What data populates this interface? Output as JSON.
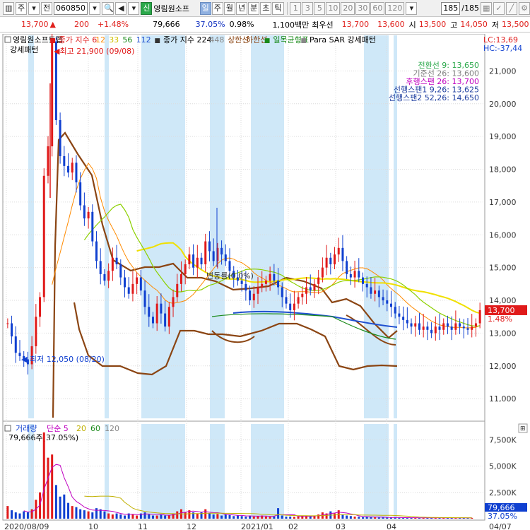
{
  "toolbar": {
    "period_btn": "주",
    "prev_btn": "전",
    "code": "060850",
    "market_badge": "신",
    "stock_name": "영림원소프",
    "tabs": [
      "일",
      "주",
      "월",
      "년",
      "분",
      "초",
      "틱"
    ],
    "active_tab": "일",
    "intervals": [
      "1",
      "3",
      "5",
      "10",
      "20",
      "30",
      "60",
      "120"
    ],
    "count": "185",
    "total": "/185"
  },
  "info": {
    "price": "13,700",
    "change_arrow": "▲",
    "change": "200",
    "change_pct": "+1.48%",
    "volume": "79,666",
    "vol_ratio": "37.05%",
    "turnover": "0.98%",
    "amount": "1,100백만",
    "quote_label": "최우선",
    "ask": "13,700",
    "bid": "13,600",
    "open_label": "시",
    "open": "13,500",
    "high_label": "고",
    "high": "14,050",
    "low_label": "저",
    "low": "13,500"
  },
  "legend": {
    "name": "영림원소프트랩",
    "ma_label": "종가 지수 6",
    "ma12": "12",
    "ma33": "33",
    "ma56": "56",
    "ma112": "112",
    "bb_label": "종가 지수 224",
    "bb448": "448",
    "upper": "상한선",
    "lower": "하한선",
    "ichimoku": "일목균형표",
    "sar": "Para SAR 강세패턴",
    "pattern": "강세패턴",
    "lc": "LC:13,69",
    "hc": "HC:-37,44"
  },
  "ichimoku_legend": [
    {
      "label": "전환선 9: 13,650",
      "color": "#2aa84a"
    },
    {
      "label": "기준선 26: 13,600",
      "color": "#7f7f7f"
    },
    {
      "label": "후행스팬 26: 13,700",
      "color": "#c000c0"
    },
    {
      "label": "선행스팬1 9,26: 13,625",
      "color": "#1f3fa0"
    },
    {
      "label": "선행스팬2 52,26: 14,650",
      "color": "#1f3fa0"
    }
  ],
  "annotations": {
    "high": "최고 21,900 (09/08)",
    "low": "최저 12,050 (08/20)",
    "overlap": "변동률(0,0%)"
  },
  "price_axis": [
    "21,000",
    "20,000",
    "19,000",
    "18,000",
    "17,000",
    "16,000",
    "15,000",
    "14,000",
    "13,000",
    "12,000",
    "11,000"
  ],
  "price_badge": {
    "price": "13,700",
    "pct": "1.48%"
  },
  "volume_legend": {
    "label": "거래량",
    "simple": "단순 5",
    "m20": "20",
    "m60": "60",
    "m120": "120",
    "value": "79,666주(37.05%)"
  },
  "volume_axis": [
    "7,500K",
    "5,000K",
    "2,500K"
  ],
  "volume_badge": {
    "value": "79,666",
    "pct": "37.05%"
  },
  "date_axis": [
    "2020/08/09",
    "10",
    "11",
    "12",
    "2021/01",
    "02",
    "03",
    "04"
  ],
  "date_right": "04/07",
  "chart_data": {
    "type": "candlestick",
    "price_range": [
      10400,
      22000
    ],
    "volume_range": [
      0,
      9000000
    ],
    "close": [
      13300,
      12900,
      12400,
      12300,
      12200,
      12050,
      12600,
      13500,
      14100,
      17800,
      18700,
      21900,
      19500,
      18400,
      18100,
      17900,
      18200,
      17600,
      16900,
      16500,
      16700,
      15800,
      15200,
      14800,
      14600,
      14900,
      15300,
      15100,
      14700,
      14400,
      14200,
      14500,
      14700,
      14300,
      13800,
      13500,
      13300,
      13900,
      13600,
      13200,
      13800,
      14100,
      14500,
      14800,
      15100,
      15400,
      15000,
      15300,
      15100,
      15800,
      15500,
      15200,
      15600,
      15400,
      15200,
      14900,
      14700,
      14600,
      14500,
      14300,
      14000,
      14200,
      14400,
      14500,
      14600,
      14800,
      14600,
      14400,
      14100,
      13900,
      13700,
      13900,
      14100,
      14200,
      14400,
      14300,
      14500,
      14700,
      15000,
      15300,
      15100,
      15400,
      15600,
      15200,
      14800,
      14700,
      14900,
      14700,
      14500,
      14400,
      14200,
      14300,
      14100,
      14000,
      13900,
      13800,
      13600,
      13500,
      13400,
      13300,
      13200,
      13300,
      13100,
      13200,
      13100,
      13000,
      13200,
      13100,
      13300,
      13200,
      13100,
      13300,
      13200,
      13150,
      13100,
      13200,
      13300,
      13700
    ],
    "volume": [
      1200000,
      800000,
      600000,
      500000,
      700000,
      600000,
      900000,
      1800000,
      2500000,
      8200000,
      5800000,
      6100000,
      3200000,
      2100000,
      2300000,
      1500000,
      1200000,
      1100000,
      900000,
      800000,
      700000,
      600000,
      1000000,
      900000,
      700000,
      500000,
      400000,
      500000,
      400000,
      300000,
      500000,
      400000,
      300000,
      500000,
      600000,
      400000,
      300000,
      300000,
      400000,
      300000,
      350000,
      500000,
      700000,
      900000,
      600000,
      800000,
      600000,
      500000,
      600000,
      900000,
      500000,
      400000,
      450000,
      300000,
      400000,
      350000,
      250000,
      300000,
      250000,
      200000,
      300000,
      200000,
      250000,
      300000,
      200000,
      180000,
      200000,
      1000000,
      300000,
      200000,
      200000,
      180000,
      200000,
      300000,
      250000,
      200000,
      300000,
      400000,
      600000,
      500000,
      700000,
      500000,
      800000,
      400000,
      300000,
      250000,
      200000,
      180000,
      150000,
      200000,
      150000,
      130000,
      120000,
      150000,
      100000,
      120000,
      100000,
      90000,
      100000,
      80000,
      90000,
      100000,
      80000,
      90000,
      85000,
      80000,
      90000,
      100000,
      80000,
      90000,
      85000,
      80000,
      90000,
      85000,
      80000,
      79666
    ]
  }
}
